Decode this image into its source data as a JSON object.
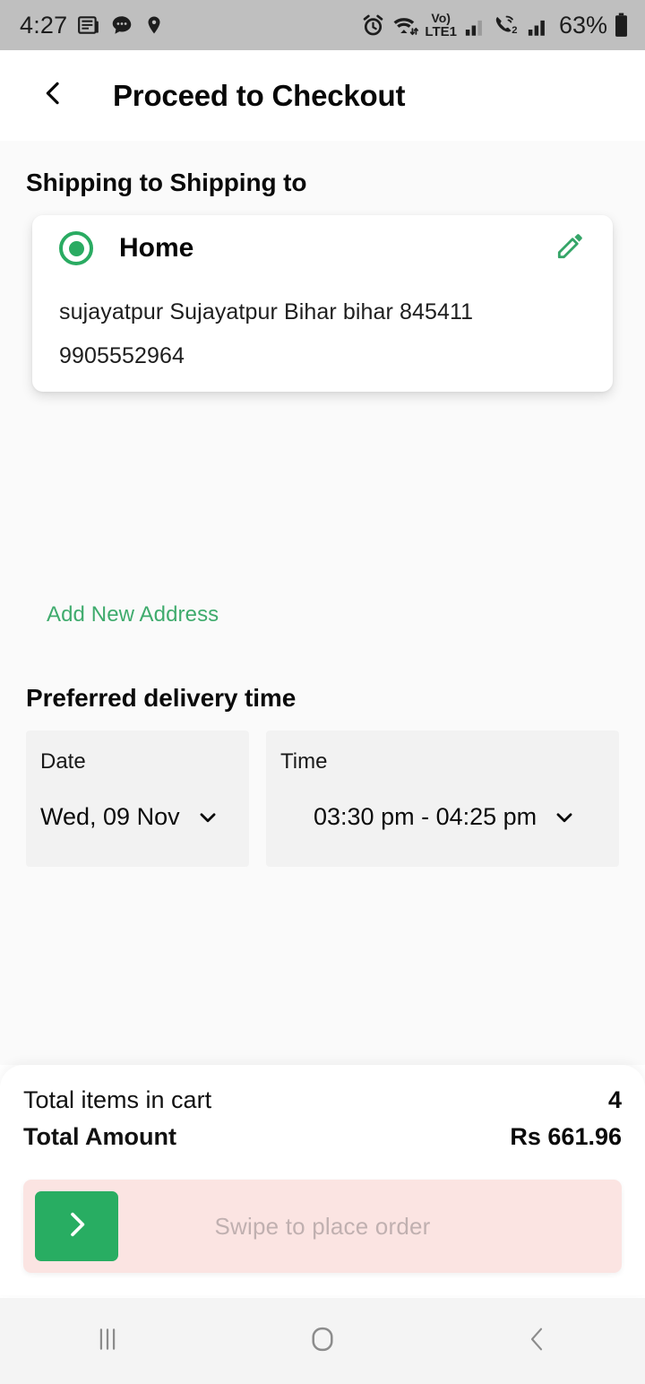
{
  "status_bar": {
    "time": "4:27",
    "left_icons": [
      "news-icon",
      "chat-bubble-icon",
      "location-pin-icon"
    ],
    "right_icons": [
      "alarm-icon",
      "wifi-icon",
      "volte-lte1-icon",
      "signal-bars-sim1-icon",
      "call-sim2-icon",
      "signal-bars-sim2-icon"
    ],
    "network_label": "Vo)",
    "network_sub": "LTE1",
    "sim2_label": "2",
    "battery_percent": "63%",
    "battery_icon": "battery-icon"
  },
  "header": {
    "back_icon": "chevron-left-icon",
    "title": "Proceed to Checkout"
  },
  "shipping": {
    "section_title": "Shipping to Shipping to",
    "address": {
      "selected": true,
      "radio_icon": "radio-selected-icon",
      "label": "Home",
      "edit_icon": "pencil-icon",
      "line1": "sujayatpur Sujayatpur Bihar bihar 845411",
      "line2": "9905552964"
    },
    "add_new_label": "Add New Address"
  },
  "delivery": {
    "section_title": "Preferred delivery time",
    "date": {
      "caption": "Date",
      "value": "Wed, 09 Nov",
      "caret_icon": "chevron-down-icon"
    },
    "time": {
      "caption": "Time",
      "value": "03:30 pm - 04:25 pm",
      "caret_icon": "chevron-down-icon"
    }
  },
  "summary": {
    "items_label": "Total items in cart",
    "items_value": "4",
    "amount_label": "Total Amount",
    "amount_value": "Rs 661.96"
  },
  "swipe": {
    "hint": "Swipe to place order",
    "thumb_icon": "chevron-right-icon"
  },
  "nav_bar": {
    "recents_icon": "recents-icon",
    "home_icon": "home-icon",
    "back_icon": "back-icon"
  },
  "colors": {
    "accent_green": "#2aab62",
    "link_green": "#3fab6d",
    "swipe_track": "#fbe4e2",
    "page_bg": "#fafafa",
    "status_bar_bg": "#bfbfbf"
  }
}
